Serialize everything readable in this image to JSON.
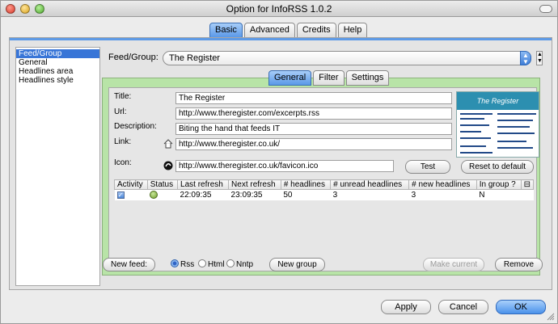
{
  "window": {
    "title": "Option for InfoRSS 1.0.2"
  },
  "top_tabs": [
    "Basic",
    "Advanced",
    "Credits",
    "Help"
  ],
  "sidebar": {
    "items": [
      "Feed/Group",
      "General",
      "Headlines area",
      "Headlines style"
    ]
  },
  "feed": {
    "label": "Feed/Group:",
    "selected": "The Register"
  },
  "inner_tabs": [
    "General",
    "Filter",
    "Settings"
  ],
  "form": {
    "title_label": "Title:",
    "title_value": "The Register",
    "url_label": "Url:",
    "url_value": "http://www.theregister.com/excerpts.rss",
    "description_label": "Description:",
    "description_value": "Biting the hand that feeds IT",
    "link_label": "Link:",
    "link_value": "http://www.theregister.co.uk/",
    "icon_label": "Icon:",
    "icon_value": "http://www.theregister.co.uk/favicon.ico",
    "test_button": "Test",
    "reset_button": "Reset to default"
  },
  "preview": {
    "banner_text": "The Register"
  },
  "table": {
    "headers": [
      "Activity",
      "Status",
      "Last refresh",
      "Next refresh",
      "# headlines",
      "# unread headlines",
      "# new headlines",
      "In group ?"
    ],
    "row": {
      "activity_checked": true,
      "last_refresh": "22:09:35",
      "next_refresh": "23:09:35",
      "headlines": "50",
      "unread": "3",
      "new": "3",
      "in_group": "N"
    }
  },
  "bottom": {
    "new_feed": "New feed:",
    "radio_rss": "Rss",
    "radio_html": "Html",
    "radio_nntp": "Nntp",
    "new_group": "New group",
    "make_current": "Make current",
    "remove": "Remove"
  },
  "footer": {
    "apply": "Apply",
    "cancel": "Cancel",
    "ok": "OK"
  },
  "colors": {
    "accent": "#3875d7",
    "green_panel": "#b8e4a7",
    "panel_bg": "#e6e6e6"
  }
}
